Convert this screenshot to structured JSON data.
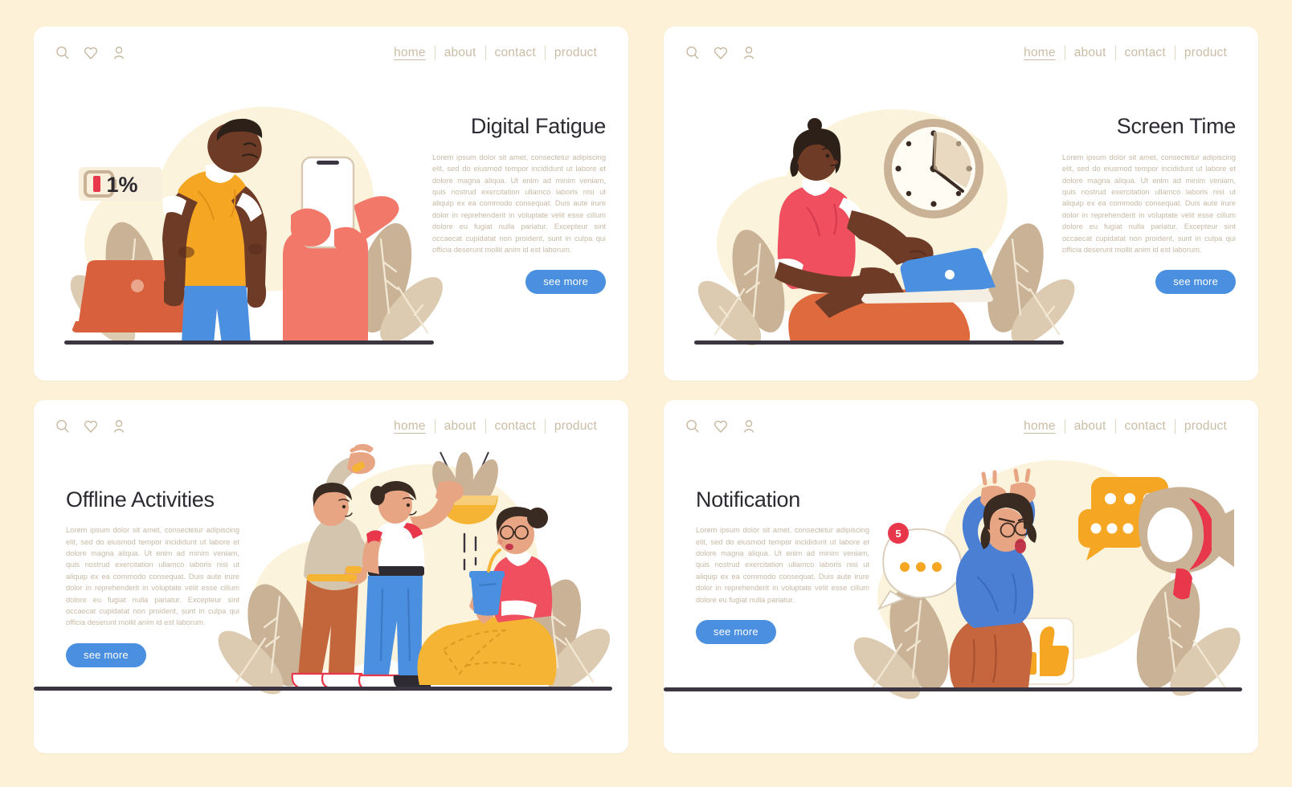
{
  "background_color": "#FDF2D8",
  "card_color": "#FFFFFF",
  "accent_button_color": "#4A8FE0",
  "nav": {
    "icons": [
      "search-icon",
      "heart-icon",
      "user-icon"
    ],
    "links": [
      {
        "label": "home",
        "active": true
      },
      {
        "label": "about",
        "active": false
      },
      {
        "label": "contact",
        "active": false
      },
      {
        "label": "product",
        "active": false
      }
    ]
  },
  "common": {
    "button_label": "see more",
    "body_full": "Lorem ipsum dolor sit amet, consectetur adipiscing elit, sed do eiusmod tempor incididunt ut labore et dolore magna aliqua. Ut enim ad minim veniam, quis nostrud exercitation ullamco laboris nisi ut aliquip ex ea commodo consequat. Duis aute irure dolor in reprehenderit in voluptate velit esse cillum dolore eu fugiat nulla pariatur. Excepteur sint occaecat cupidatat non proident, sunt in culpa qui officia deserunt mollit anim id est laborum.",
    "body_short": "Lorem ipsum dolor sit amet, consectetur adipiscing elit, sed do eiusmod tempor incididunt ut labore et dolore magna aliqua. Ut enim ad minim veniam, quis nostrud exercitation ullamco laboris nisi ut aliquip ex ea commodo consequat. Duis aute irure dolor in reprehenderit in voluptate velit esse cillum dolore eu fugiat nulla pariatur."
  },
  "cards": [
    {
      "id": "digital-fatigue",
      "title": "Digital Fatigue",
      "text_side": "right",
      "illustration": "tired-man-with-phone-and-laptop",
      "badge_label": "1%"
    },
    {
      "id": "screen-time",
      "title": "Screen Time",
      "text_side": "right",
      "illustration": "woman-on-laptop-with-wall-clock"
    },
    {
      "id": "offline-activities",
      "title": "Offline Activities",
      "text_side": "left",
      "illustration": "three-people-stretching-watering-plant-drinking"
    },
    {
      "id": "notification",
      "title": "Notification",
      "text_side": "left",
      "illustration": "stressed-woman-with-megaphone-and-chat-bubbles",
      "badge_label": "5"
    }
  ],
  "palette": {
    "cream_blob": "#FBF3DC",
    "leaf": "#C9B295",
    "leaf_light": "#DCCBB0",
    "skin_dark": "#6E3B27",
    "skin_light": "#E8A584",
    "shirt_yellow": "#F5A623",
    "pants_blue": "#4A8FE0",
    "laptop_orange": "#D9603C",
    "hand_salmon": "#F2786A",
    "shirt_pink": "#EF4F5F",
    "pants_orange": "#DE6A3E",
    "shirt_blue": "#4A7FD4",
    "pants_rust": "#C5663E",
    "bubble_yellow": "#F5A623",
    "megaphone_tan": "#C9B295",
    "megaphone_red": "#E8374A",
    "badge_red": "#E8374A",
    "battery_red": "#E8374A",
    "floor_line": "#3A3540"
  }
}
